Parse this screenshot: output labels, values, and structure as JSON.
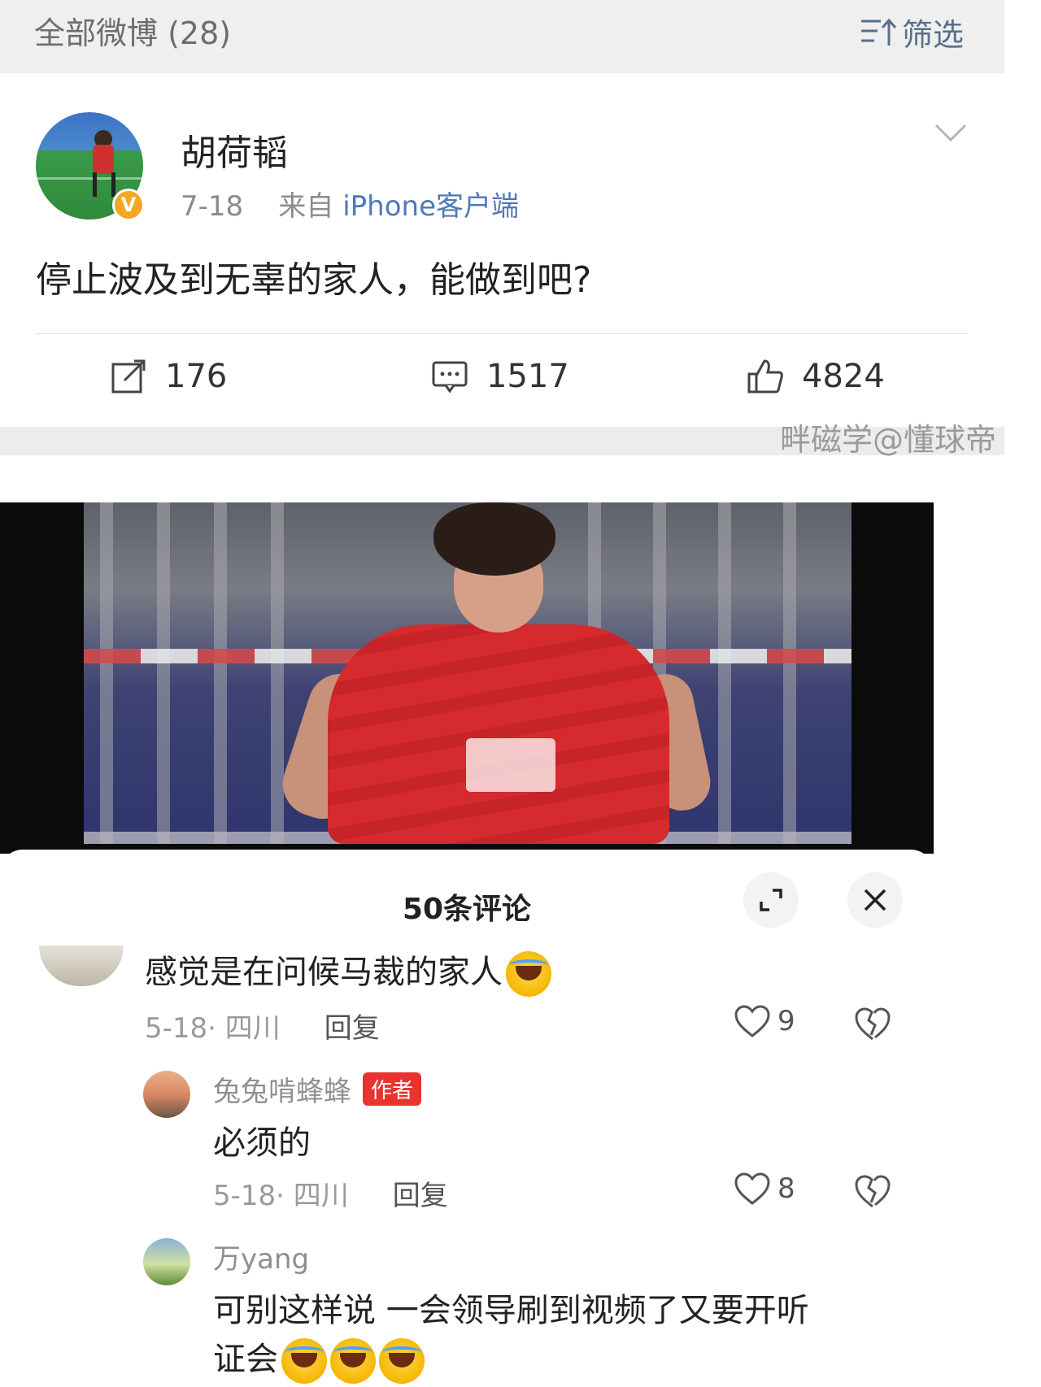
{
  "header": {
    "filter_title": "全部微博 (28)",
    "filter_label": "筛选"
  },
  "post": {
    "author": "胡荷韬",
    "date": "7-18",
    "source_prefix": "来自",
    "source": "iPhone客户端",
    "text": "停止波及到无辜的家人，能做到吧?",
    "shares": "176",
    "comments": "1517",
    "likes": "4824"
  },
  "watermark": "畔磁学@懂球帝",
  "comments_sheet": {
    "title": "50条评论",
    "comments": [
      {
        "text": "感觉是在问候马裁的家人",
        "date": "5-18",
        "location": "四川",
        "reply_label": "回复",
        "likes": "9"
      }
    ],
    "replies": [
      {
        "user": "兔兔啃蜂蜂",
        "tag": "作者",
        "text": "必须的",
        "date": "5-18",
        "location": "四川",
        "reply_label": "回复",
        "likes": "8"
      },
      {
        "user": "万yang",
        "text_line1": "可别这样说   一会领导刷到视频了又要开听",
        "text_line2": "证会"
      }
    ]
  },
  "colors": {
    "link_blue": "#4f79b8",
    "badge_orange": "#f5a623",
    "author_tag_red": "#e8332f"
  }
}
